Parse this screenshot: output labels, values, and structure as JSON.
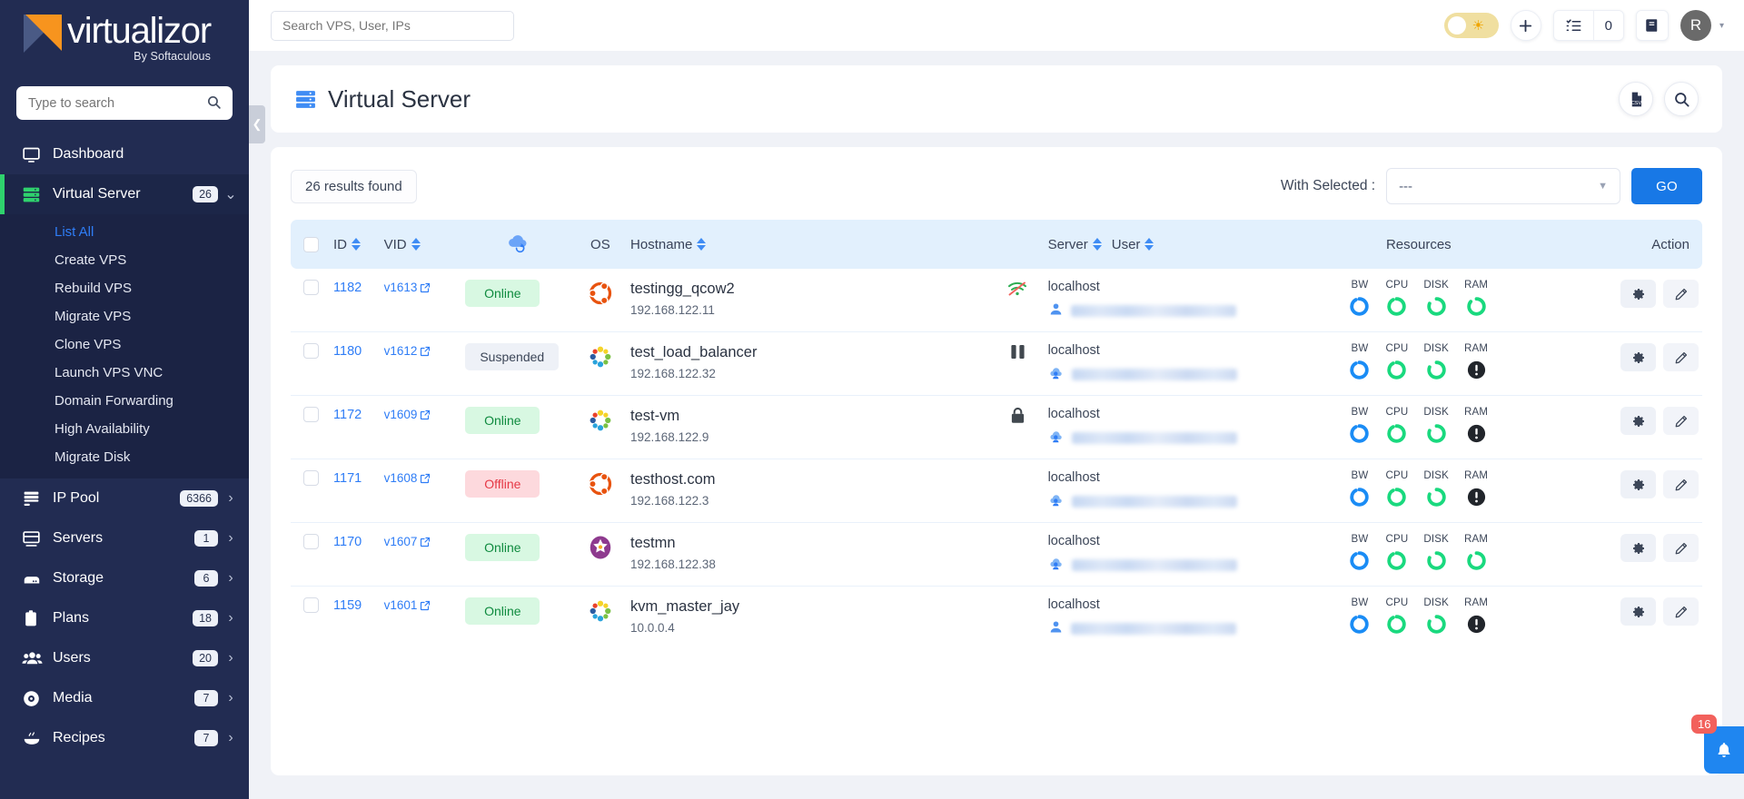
{
  "brand": {
    "name": "virtualizor",
    "tagline": "By Softaculous"
  },
  "sidebar": {
    "search_placeholder": "Type to search",
    "items": [
      {
        "label": "Dashboard",
        "icon": "monitor-icon",
        "badge": "",
        "chevron": ""
      },
      {
        "label": "Virtual Server",
        "icon": "server-stack-icon",
        "badge": "26",
        "chevron": "⌄"
      },
      {
        "label": "IP Pool",
        "icon": "ip-pool-icon",
        "badge": "6366",
        "chevron": "›"
      },
      {
        "label": "Servers",
        "icon": "server-icon",
        "badge": "1",
        "chevron": "›"
      },
      {
        "label": "Storage",
        "icon": "storage-icon",
        "badge": "6",
        "chevron": "›"
      },
      {
        "label": "Plans",
        "icon": "clipboard-icon",
        "badge": "18",
        "chevron": "›"
      },
      {
        "label": "Users",
        "icon": "users-icon",
        "badge": "20",
        "chevron": "›"
      },
      {
        "label": "Media",
        "icon": "disc-icon",
        "badge": "7",
        "chevron": "›"
      },
      {
        "label": "Recipes",
        "icon": "recipe-icon",
        "badge": "7",
        "chevron": "›"
      }
    ],
    "submenu": [
      {
        "label": "List All",
        "selected": true
      },
      {
        "label": "Create VPS",
        "selected": false
      },
      {
        "label": "Rebuild VPS",
        "selected": false
      },
      {
        "label": "Migrate VPS",
        "selected": false
      },
      {
        "label": "Clone VPS",
        "selected": false
      },
      {
        "label": "Launch VPS VNC",
        "selected": false
      },
      {
        "label": "Domain Forwarding",
        "selected": false
      },
      {
        "label": "High Availability",
        "selected": false
      },
      {
        "label": "Migrate Disk",
        "selected": false
      }
    ]
  },
  "topbar": {
    "search_placeholder": "Search VPS, User, IPs",
    "theme_toggle": "sun-icon",
    "add_label": "+",
    "task_count": "0",
    "avatar_initial": "R",
    "caret": "▾"
  },
  "page": {
    "title": "Virtual Server",
    "export_icon": "csv-export-icon",
    "search_icon": "search-icon"
  },
  "toolbar": {
    "results_found": "26 results found",
    "with_selected_label": "With Selected :",
    "select_value": "---",
    "go_label": "GO"
  },
  "table": {
    "headers": {
      "id": "ID",
      "vid": "VID",
      "cloud": "cloud-sync-icon",
      "os": "OS",
      "hostname": "Hostname",
      "server": "Server",
      "user": "User",
      "resources": "Resources",
      "action": "Action"
    },
    "resource_labels": [
      "BW",
      "CPU",
      "DISK",
      "RAM"
    ],
    "rows": [
      {
        "id": "1182",
        "vid": "v1613",
        "status": "Online",
        "status_type": "online",
        "os": "ubuntu",
        "hostname": "testingg_qcow2",
        "ip": "192.168.122.11",
        "state_icon": "wifi-off-icon",
        "server": "localhost",
        "user_icon": "user-icon",
        "res": [
          "bw",
          "cpu",
          "disk",
          "ram"
        ],
        "res_state": [
          "ok",
          "ok",
          "ok",
          "ok"
        ]
      },
      {
        "id": "1180",
        "vid": "v1612",
        "status": "Suspended",
        "status_type": "suspended",
        "os": "centos",
        "hostname": "test_load_balancer",
        "ip": "192.168.122.32",
        "state_icon": "pause-icon",
        "server": "localhost",
        "user_icon": "cloud-user-icon",
        "res": [
          "bw",
          "cpu",
          "disk",
          "ram"
        ],
        "res_state": [
          "ok",
          "ok",
          "ok",
          "alert"
        ]
      },
      {
        "id": "1172",
        "vid": "v1609",
        "status": "Online",
        "status_type": "online",
        "os": "centos",
        "hostname": "test-vm",
        "ip": "192.168.122.9",
        "state_icon": "lock-icon",
        "server": "localhost",
        "user_icon": "cloud-user-icon",
        "res": [
          "bw",
          "cpu",
          "disk",
          "ram"
        ],
        "res_state": [
          "ok",
          "ok",
          "ok",
          "alert"
        ]
      },
      {
        "id": "1171",
        "vid": "v1608",
        "status": "Offline",
        "status_type": "offline",
        "os": "ubuntu",
        "hostname": "testhost.com",
        "ip": "192.168.122.3",
        "state_icon": "",
        "server": "localhost",
        "user_icon": "cloud-user-icon",
        "res": [
          "bw",
          "cpu",
          "disk",
          "ram"
        ],
        "res_state": [
          "ok",
          "ok",
          "ok",
          "alert"
        ]
      },
      {
        "id": "1170",
        "vid": "v1607",
        "status": "Online",
        "status_type": "online",
        "os": "almalinux",
        "hostname": "testmn",
        "ip": "192.168.122.38",
        "state_icon": "",
        "server": "localhost",
        "user_icon": "cloud-user-icon",
        "res": [
          "bw",
          "cpu",
          "disk",
          "ram"
        ],
        "res_state": [
          "ok",
          "ok",
          "ok",
          "ok"
        ]
      },
      {
        "id": "1159",
        "vid": "v1601",
        "status": "Online",
        "status_type": "online",
        "os": "centos",
        "hostname": "kvm_master_jay",
        "ip": "10.0.0.4",
        "state_icon": "",
        "server": "localhost",
        "user_icon": "user-icon",
        "res": [
          "bw",
          "cpu",
          "disk",
          "ram"
        ],
        "res_state": [
          "ok",
          "ok",
          "ok",
          "alert"
        ]
      }
    ]
  },
  "notification": {
    "count": "16",
    "icon": "bell-icon"
  },
  "colors": {
    "sidebar_bg": "#222c52",
    "accent_blue": "#1878e6",
    "green": "#2fd26d",
    "status_online_bg": "#d8f8e2",
    "status_offline_bg": "#fdd9dd",
    "table_header_bg": "#e2f0fd"
  }
}
